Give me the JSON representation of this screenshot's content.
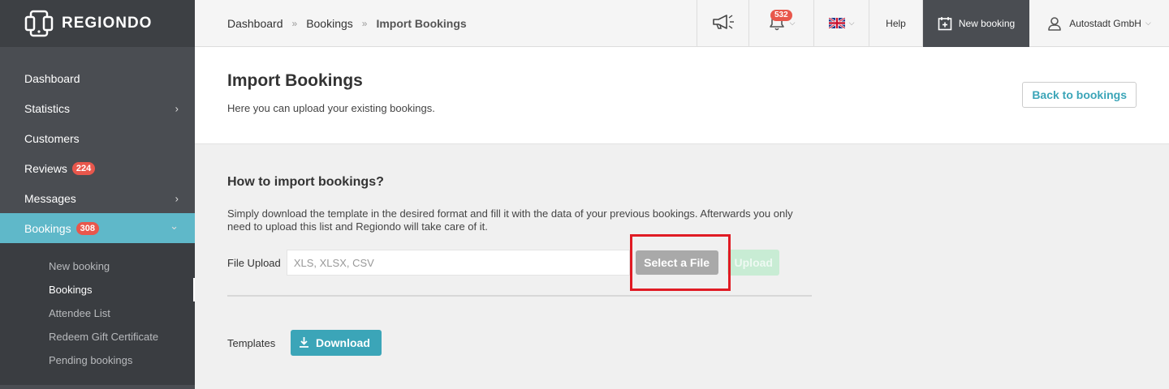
{
  "brand": {
    "name": "REGIONDO"
  },
  "sidebar": {
    "items": [
      {
        "label": "Dashboard"
      },
      {
        "label": "Statistics",
        "chevron": "›"
      },
      {
        "label": "Customers"
      },
      {
        "label": "Reviews",
        "badge": "224"
      },
      {
        "label": "Messages",
        "chevron": "›"
      },
      {
        "label": "Bookings",
        "badge": "308",
        "chevron": "⌄"
      }
    ],
    "subitems": [
      {
        "label": "New booking"
      },
      {
        "label": "Bookings"
      },
      {
        "label": "Attendee List"
      },
      {
        "label": "Redeem Gift Certificate"
      },
      {
        "label": "Pending bookings"
      }
    ]
  },
  "topbar": {
    "breadcrumb": [
      "Dashboard",
      "Bookings",
      "Import Bookings"
    ],
    "breadcrumb_sep": "»",
    "notifications_count": "532",
    "help_label": "Help",
    "new_booking_label": "New booking",
    "account_label": "Autostadt GmbH"
  },
  "header": {
    "title": "Import Bookings",
    "subtitle": "Here you can upload your existing bookings.",
    "back_label": "Back to bookings"
  },
  "content": {
    "section_title": "How to import bookings?",
    "description": "Simply download the template in the desired format and fill it with the data of your previous bookings. Afterwards you only need to upload this list and Regiondo will take care of it.",
    "file_upload_label": "File Upload",
    "file_placeholder": "XLS, XLSX, CSV",
    "select_file_label": "Select a File",
    "upload_label": "Upload",
    "templates_label": "Templates",
    "download_label": "Download"
  },
  "colors": {
    "accent": "#3ba5b8",
    "sidebar_bg": "#4a4d52",
    "active_nav": "#5fb8c9",
    "badge": "#e8574c",
    "highlight": "#e01b24"
  },
  "icons": {
    "logo": "regiondo-logo-icon",
    "announce": "megaphone-icon",
    "bell": "bell-icon",
    "flag": "uk-flag-icon",
    "calendar_plus": "calendar-plus-icon",
    "user": "user-icon",
    "download": "download-icon"
  }
}
